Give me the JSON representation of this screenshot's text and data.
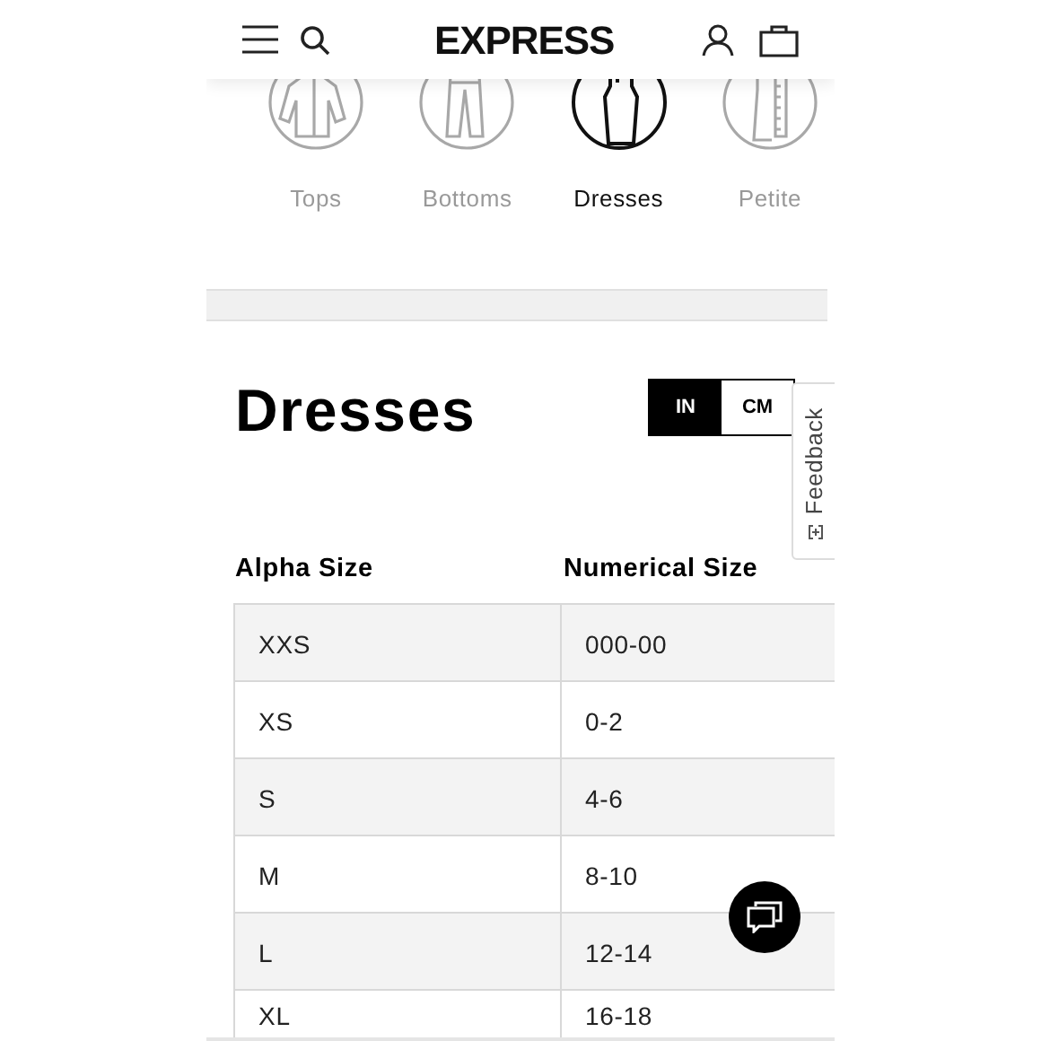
{
  "header": {
    "logo": "EXPRESS"
  },
  "categories": [
    {
      "label": "Tops",
      "kind": "top",
      "selected": false
    },
    {
      "label": "Bottoms",
      "kind": "pants",
      "selected": false
    },
    {
      "label": "Dresses",
      "kind": "dress",
      "selected": true
    },
    {
      "label": "Petite",
      "kind": "petite",
      "selected": false
    }
  ],
  "size_chart": {
    "title": "Dresses",
    "units": [
      {
        "label": "IN",
        "selected": true
      },
      {
        "label": "CM",
        "selected": false
      }
    ],
    "columns": [
      "Alpha Size",
      "Numerical Size"
    ],
    "rows": [
      [
        "XXS",
        "000-00"
      ],
      [
        "XS",
        "0-2"
      ],
      [
        "S",
        "4-6"
      ],
      [
        "M",
        "8-10"
      ],
      [
        "L",
        "12-14"
      ],
      [
        "XL",
        "16-18"
      ]
    ]
  },
  "feedback_tab": {
    "label": "Feedback"
  }
}
